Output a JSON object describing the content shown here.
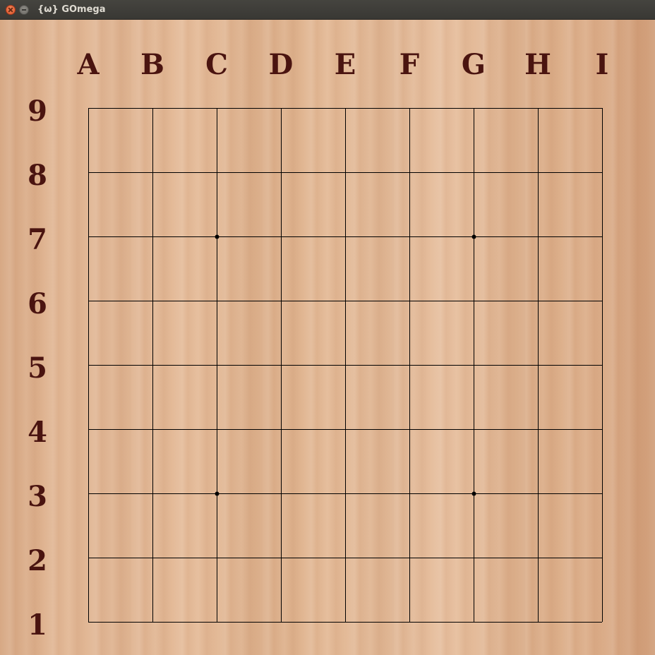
{
  "window": {
    "title": "{ω} GOmega"
  },
  "board": {
    "size": 9,
    "columns": [
      "A",
      "B",
      "C",
      "D",
      "E",
      "F",
      "G",
      "H",
      "I"
    ],
    "rows": [
      "9",
      "8",
      "7",
      "6",
      "5",
      "4",
      "3",
      "2",
      "1"
    ],
    "line_color": "#000000",
    "label_color": "#4a1410",
    "star_points": [
      {
        "col": "C",
        "row": "7"
      },
      {
        "col": "G",
        "row": "7"
      },
      {
        "col": "C",
        "row": "3"
      },
      {
        "col": "G",
        "row": "3"
      }
    ],
    "stones": []
  }
}
